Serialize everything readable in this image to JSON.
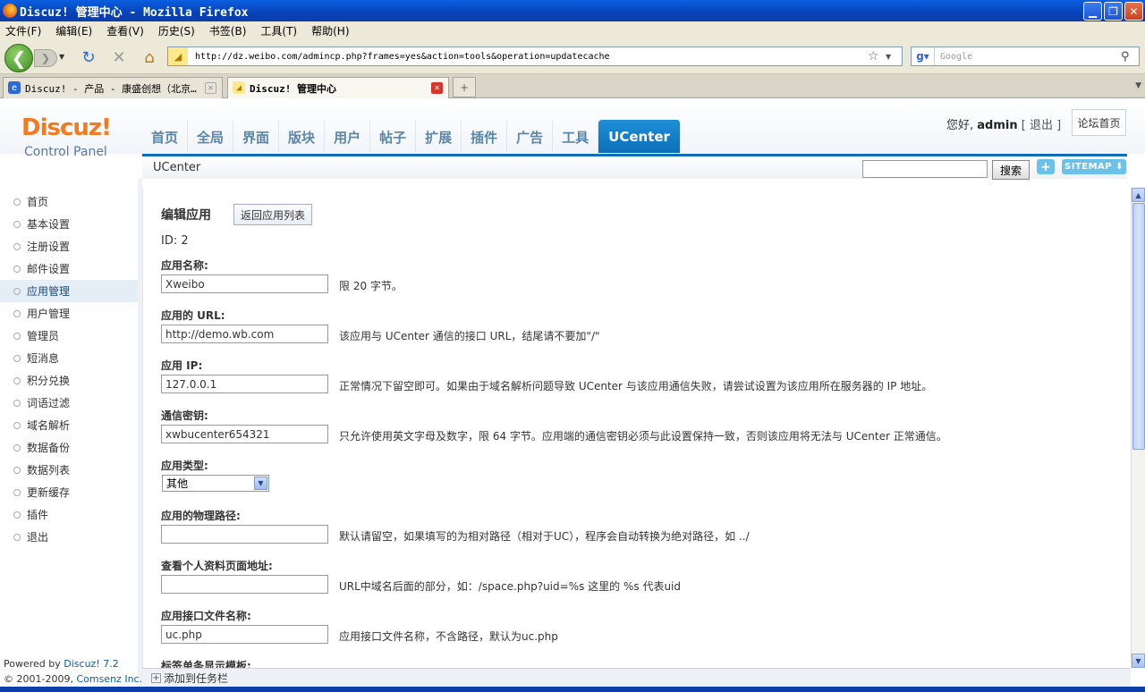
{
  "window": {
    "title": "Discuz! 管理中心 - Mozilla Firefox"
  },
  "menu": [
    "文件(F)",
    "编辑(E)",
    "查看(V)",
    "历史(S)",
    "书签(B)",
    "工具(T)",
    "帮助(H)"
  ],
  "browser": {
    "url": "http://dz.weibo.com/admincp.php?frames=yes&action=tools&operation=updatecache",
    "search_placeholder": "Google"
  },
  "tabs": [
    {
      "label": "Discuz! - 产品 - 康盛创想（北京…"
    },
    {
      "label": "Discuz! 管理中心"
    }
  ],
  "header": {
    "logo_brand": "Discuz!",
    "logo_sub": "Control Panel",
    "nav": [
      "首页",
      "全局",
      "界面",
      "版块",
      "用户",
      "帖子",
      "扩展",
      "插件",
      "广告",
      "工具",
      "UCenter"
    ],
    "greeting": "您好,",
    "username": "admin",
    "logout": "[ 退出 ]",
    "forum_home": "论坛首页"
  },
  "subbar": {
    "crumb": "UCenter",
    "search_button": "搜索",
    "plus": "+",
    "sitemap": "SITEMAP ⬇"
  },
  "sidebar": {
    "items": [
      "首页",
      "基本设置",
      "注册设置",
      "邮件设置",
      "应用管理",
      "用户管理",
      "管理员",
      "短消息",
      "积分兑换",
      "词语过滤",
      "域名解析",
      "数据备份",
      "数据列表",
      "更新缓存",
      "插件",
      "退出"
    ],
    "powered_prefix": "Powered by",
    "powered_link": "Discuz! 7.2",
    "copyright_prefix": "© 2001-2009,",
    "copyright_link": "Comsenz Inc."
  },
  "form": {
    "title": "编辑应用",
    "back_button": "返回应用列表",
    "id_line": "ID: 2",
    "fields": [
      {
        "label": "应用名称:",
        "value": "Xweibo",
        "hint": "限 20 字节。"
      },
      {
        "label": "应用的 URL:",
        "value": "http://demo.wb.com",
        "hint": "该应用与 UCenter 通信的接口 URL，结尾请不要加\"/\""
      },
      {
        "label": "应用 IP:",
        "value": "127.0.0.1",
        "hint": "正常情况下留空即可。如果由于域名解析问题导致 UCenter 与该应用通信失败，请尝试设置为该应用所在服务器的 IP 地址。"
      },
      {
        "label": "通信密钥:",
        "value": "xwbucenter654321",
        "hint": "只允许使用英文字母及数字，限 64 字节。应用端的通信密钥必须与此设置保持一致，否则该应用将无法与 UCenter 正常通信。"
      },
      {
        "label": "应用类型:",
        "value": "其他",
        "hint": ""
      },
      {
        "label": "应用的物理路径:",
        "value": "",
        "hint": "默认请留空，如果填写的为相对路径（相对于UC），程序会自动转换为绝对路径，如 ../"
      },
      {
        "label": "查看个人资料页面地址:",
        "value": "",
        "hint": "URL中域名后面的部分，如：/space.php?uid=%s 这里的 %s 代表uid"
      },
      {
        "label": "应用接口文件名称:",
        "value": "uc.php",
        "hint": "应用接口文件名称，不含路径，默认为uc.php"
      },
      {
        "label": "标签单条显示模板:",
        "value": "",
        "hint": ""
      }
    ]
  },
  "bottombar": {
    "add_task": "添加到任务栏"
  }
}
